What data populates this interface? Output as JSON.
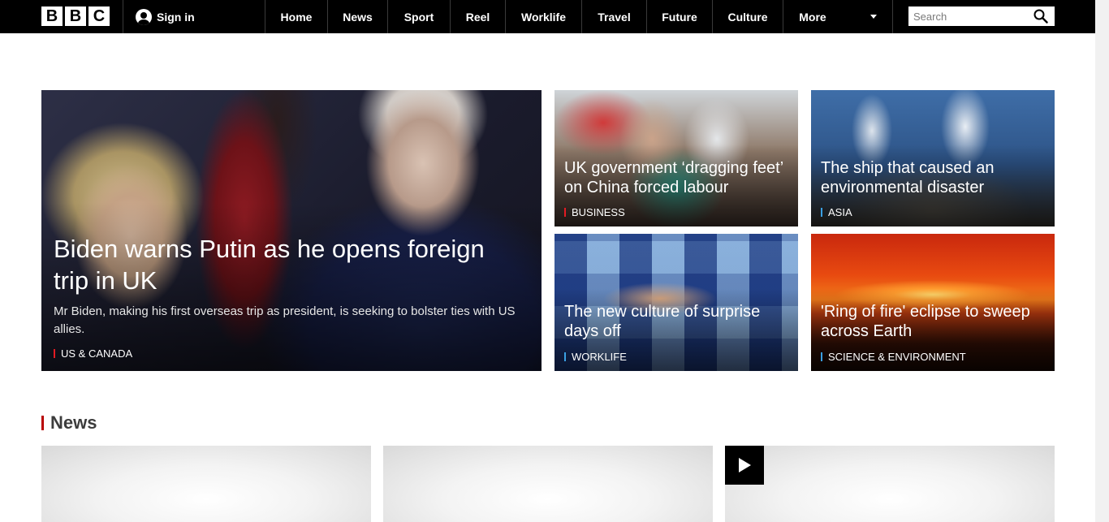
{
  "header": {
    "logo_letters": [
      "B",
      "B",
      "C"
    ],
    "signin_label": "Sign in",
    "nav": [
      {
        "label": "Home"
      },
      {
        "label": "News"
      },
      {
        "label": "Sport"
      },
      {
        "label": "Reel"
      },
      {
        "label": "Worklife"
      },
      {
        "label": "Travel"
      },
      {
        "label": "Future"
      },
      {
        "label": "Culture"
      },
      {
        "label": "More"
      }
    ],
    "search_placeholder": "Search"
  },
  "hero": {
    "title": "Biden warns Putin as he opens foreign trip in UK",
    "summary": "Mr Biden, making his first overseas trip as president, is seeking to bolster ties with US allies.",
    "tag": "US & CANADA",
    "tag_color": "#e31b23"
  },
  "stories": [
    {
      "title": "UK government ‘dragging feet’ on China forced labour",
      "tag": "BUSINESS",
      "tag_color": "#e31b23"
    },
    {
      "title": "The ship that caused an environmental disaster",
      "tag": "ASIA",
      "tag_color": "#3aa0e3"
    },
    {
      "title": "The new culture of surprise days off",
      "tag": "WORKLIFE",
      "tag_color": "#3aa0e3"
    },
    {
      "title": "'Ring of fire' eclipse to sweep across Earth",
      "tag": "SCIENCE & ENVIRONMENT",
      "tag_color": "#3aa0e3"
    }
  ],
  "news_section": {
    "heading": "News",
    "accent": "#b80000"
  },
  "colors": {
    "nav_bg": "#000000",
    "brand_red": "#b80000"
  }
}
